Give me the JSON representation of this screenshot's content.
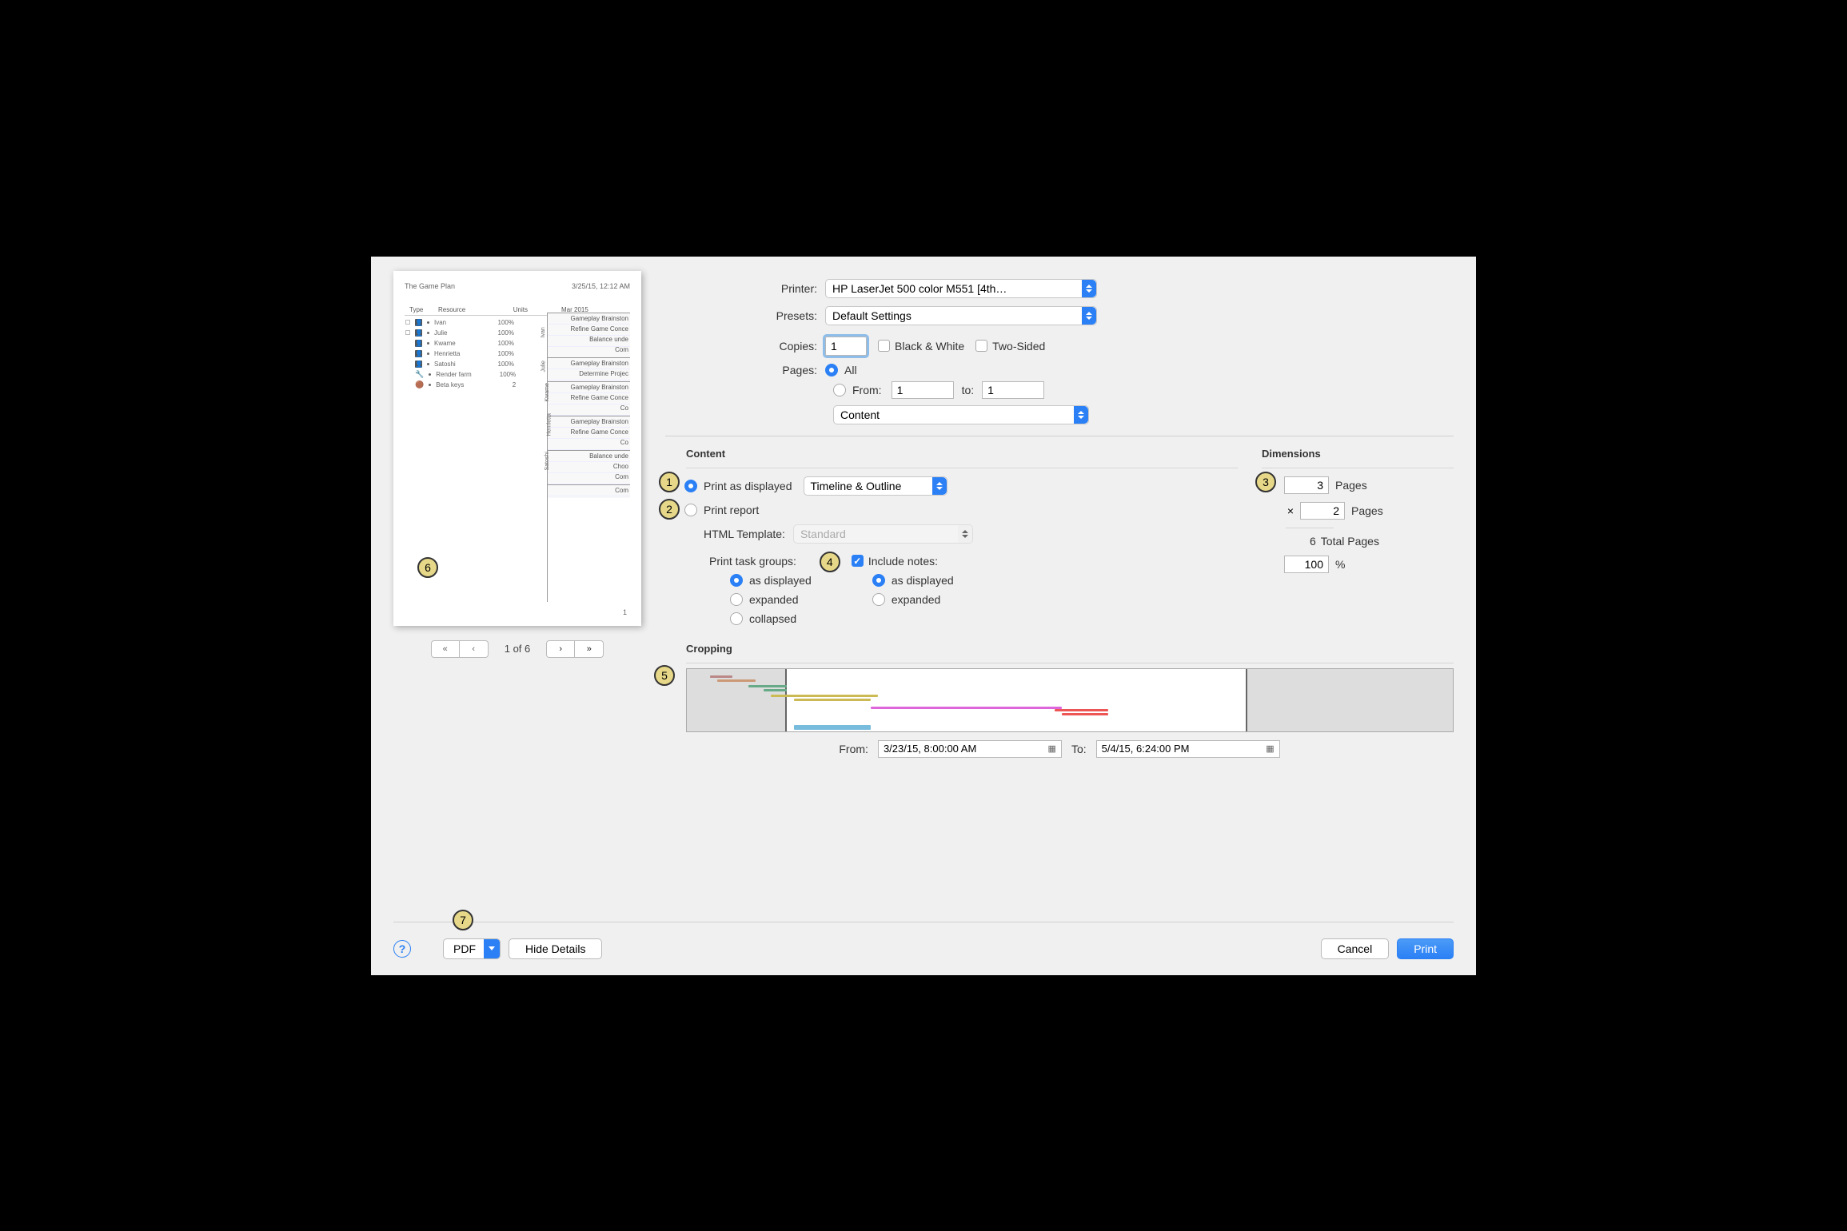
{
  "preview": {
    "doc_title": "The Game Plan",
    "doc_date": "3/25/15, 12:12 AM",
    "headers": {
      "type": "Type",
      "resource": "Resource",
      "units": "Units",
      "month": "Mar 2015"
    },
    "resources": [
      {
        "name": "Ivan",
        "units": "100%",
        "kind": "person",
        "sq": true
      },
      {
        "name": "Julie",
        "units": "100%",
        "kind": "person",
        "sq": true
      },
      {
        "name": "Kwame",
        "units": "100%",
        "kind": "person"
      },
      {
        "name": "Henrietta",
        "units": "100%",
        "kind": "person"
      },
      {
        "name": "Satoshi",
        "units": "100%",
        "kind": "person"
      },
      {
        "name": "Render farm",
        "units": "100%",
        "kind": "tool"
      },
      {
        "name": "Beta keys",
        "units": "2",
        "kind": "disc"
      }
    ],
    "sections": [
      {
        "label": "Ivan",
        "tasks": [
          "Gameplay Brainston",
          "Refine Game Conce",
          "Balance unde",
          "Com"
        ]
      },
      {
        "label": "Julie",
        "tasks": [
          "Gameplay Brainston",
          "Determine Projec"
        ]
      },
      {
        "label": "Kwame",
        "tasks": [
          "Gameplay Brainston",
          "Refine Game Conce",
          "Co"
        ]
      },
      {
        "label": "Henrietta",
        "tasks": [
          "Gameplay Brainston",
          "Refine Game Conce",
          "Co"
        ]
      },
      {
        "label": "Satoshi",
        "tasks": [
          "Balance unde",
          "Choo",
          "Com"
        ]
      },
      {
        "label": "",
        "tasks": [
          "Com"
        ]
      }
    ],
    "page_num": "1"
  },
  "pagenav": {
    "text": "1 of 6"
  },
  "printer": {
    "label": "Printer:",
    "value": "HP LaserJet 500 color M551 [4th…"
  },
  "presets": {
    "label": "Presets:",
    "value": "Default Settings"
  },
  "copies": {
    "label": "Copies:",
    "value": "1",
    "bw": "Black & White",
    "twosided": "Two-Sided"
  },
  "pages": {
    "label": "Pages:",
    "all": "All",
    "from": "From:",
    "from_val": "1",
    "to": "to:",
    "to_val": "1"
  },
  "pane_select": "Content",
  "content": {
    "title": "Content",
    "print_displayed": "Print as displayed",
    "view_select": "Timeline & Outline",
    "print_report": "Print report",
    "html_template_label": "HTML Template:",
    "html_template_value": "Standard",
    "task_groups": {
      "title": "Print task groups:",
      "as_displayed": "as displayed",
      "expanded": "expanded",
      "collapsed": "collapsed"
    },
    "notes": {
      "title": "Include notes:",
      "as_displayed": "as displayed",
      "expanded": "expanded"
    }
  },
  "dimensions": {
    "title": "Dimensions",
    "w": "3",
    "h": "2",
    "pages": "Pages",
    "times": "×",
    "total_value": "6",
    "total_label": "Total Pages",
    "pct": "100",
    "pct_label": "%"
  },
  "cropping": {
    "title": "Cropping",
    "from_label": "From:",
    "from_value": "3/23/15, 8:00:00 AM",
    "to_label": "To:",
    "to_value": "5/4/15, 6:24:00 PM"
  },
  "footer": {
    "pdf": "PDF",
    "hide": "Hide Details",
    "cancel": "Cancel",
    "print": "Print"
  },
  "badges": {
    "b1": "1",
    "b2": "2",
    "b3": "3",
    "b4": "4",
    "b5": "5",
    "b6": "6",
    "b7": "7"
  }
}
